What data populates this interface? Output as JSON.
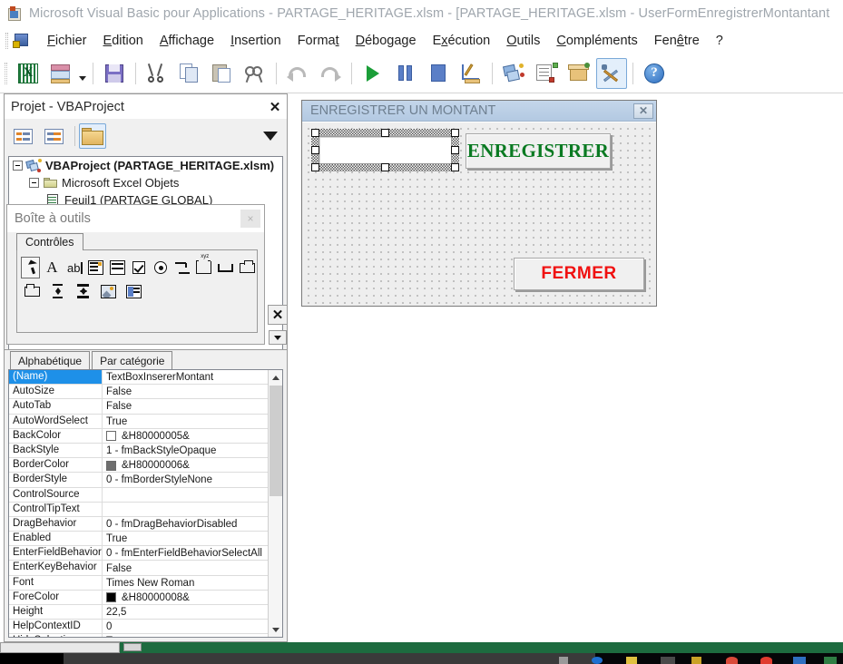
{
  "window": {
    "title": "Microsoft Visual Basic pour Applications - PARTAGE_HERITAGE.xlsm - [PARTAGE_HERITAGE.xlsm - UserFormEnregistrerMontantant",
    "app_icon": "vba-excel-icon"
  },
  "menubar": {
    "items": [
      {
        "label": "Fichier"
      },
      {
        "label": "Edition"
      },
      {
        "label": "Affichage"
      },
      {
        "label": "Insertion"
      },
      {
        "label": "Format"
      },
      {
        "label": "Débogage"
      },
      {
        "label": "Exécution"
      },
      {
        "label": "Outils"
      },
      {
        "label": "Compléments"
      },
      {
        "label": "Fenêtre"
      },
      {
        "label": "?"
      }
    ]
  },
  "toolbar": {
    "buttons": [
      {
        "name": "view-excel-icon"
      },
      {
        "name": "insert-userform-icon"
      },
      {
        "name": "save-icon"
      },
      {
        "name": "cut-icon"
      },
      {
        "name": "copy-icon"
      },
      {
        "name": "paste-icon"
      },
      {
        "name": "find-icon"
      },
      {
        "name": "undo-icon"
      },
      {
        "name": "redo-icon"
      },
      {
        "name": "run-icon"
      },
      {
        "name": "break-icon"
      },
      {
        "name": "reset-icon"
      },
      {
        "name": "design-mode-icon"
      },
      {
        "name": "project-explorer-icon"
      },
      {
        "name": "properties-window-icon"
      },
      {
        "name": "object-browser-icon"
      },
      {
        "name": "toolbox-icon"
      },
      {
        "name": "help-icon"
      }
    ]
  },
  "project_panel": {
    "title": "Projet - VBAProject",
    "close_label": "✕",
    "toolbar": {
      "view_code_label": "view-code-icon",
      "view_object_label": "view-object-icon",
      "toggle_folders_label": "toggle-folders-icon"
    },
    "tree": [
      {
        "label": "VBAProject (PARTAGE_HERITAGE.xlsm)",
        "level": 0,
        "icon": "vbaproject-icon",
        "bold": true
      },
      {
        "label": "Microsoft Excel Objets",
        "level": 1,
        "icon": "folder-icon",
        "bold": false
      },
      {
        "label": "Feuil1 (PARTAGE GLOBAL)",
        "level": 2,
        "icon": "worksheet-icon",
        "bold": false
      }
    ]
  },
  "toolbox": {
    "title": "Boîte à outils",
    "close_label": "×",
    "tabs": [
      {
        "label": "Contrôles",
        "active": true
      }
    ],
    "controls_row1": [
      {
        "name": "select-objects-icon",
        "selected": true
      },
      {
        "name": "label-icon",
        "selected": false
      },
      {
        "name": "textbox-icon",
        "selected": false
      },
      {
        "name": "combobox-icon",
        "selected": false
      },
      {
        "name": "listbox-icon",
        "selected": false
      },
      {
        "name": "checkbox-icon",
        "selected": false
      },
      {
        "name": "optionbutton-icon",
        "selected": false
      },
      {
        "name": "togglebutton-icon",
        "selected": false
      },
      {
        "name": "frame-icon",
        "selected": false
      },
      {
        "name": "commandbutton-icon",
        "selected": false
      },
      {
        "name": "tabstrip-icon",
        "selected": false
      }
    ],
    "controls_row2": [
      {
        "name": "multipage-icon",
        "selected": false
      },
      {
        "name": "scrollbar-icon",
        "selected": false
      },
      {
        "name": "spinbutton-icon",
        "selected": false
      },
      {
        "name": "image-icon",
        "selected": false
      },
      {
        "name": "refedit-icon",
        "selected": false
      }
    ]
  },
  "properties": {
    "tabs": [
      {
        "label": "Alphabétique",
        "active": true
      },
      {
        "label": "Par catégorie",
        "active": false
      }
    ],
    "rows": [
      {
        "key": "(Name)",
        "value": "TextBoxInsererMontant",
        "selected": true
      },
      {
        "key": "AutoSize",
        "value": "False"
      },
      {
        "key": "AutoTab",
        "value": "False"
      },
      {
        "key": "AutoWordSelect",
        "value": "True"
      },
      {
        "key": "BackColor",
        "value": "&H80000005&",
        "swatch": "#ffffff"
      },
      {
        "key": "BackStyle",
        "value": "1 - fmBackStyleOpaque"
      },
      {
        "key": "BorderColor",
        "value": "&H80000006&",
        "swatch": "#6e6e6e"
      },
      {
        "key": "BorderStyle",
        "value": "0 - fmBorderStyleNone"
      },
      {
        "key": "ControlSource",
        "value": ""
      },
      {
        "key": "ControlTipText",
        "value": ""
      },
      {
        "key": "DragBehavior",
        "value": "0 - fmDragBehaviorDisabled"
      },
      {
        "key": "Enabled",
        "value": "True"
      },
      {
        "key": "EnterFieldBehavior",
        "value": "0 - fmEnterFieldBehaviorSelectAll"
      },
      {
        "key": "EnterKeyBehavior",
        "value": "False"
      },
      {
        "key": "Font",
        "value": "Times New Roman"
      },
      {
        "key": "ForeColor",
        "value": "&H80000008&",
        "swatch": "#000000"
      },
      {
        "key": "Height",
        "value": "22,5"
      },
      {
        "key": "HelpContextID",
        "value": "0"
      },
      {
        "key": "HideSelection",
        "value": "True"
      }
    ]
  },
  "designer": {
    "form_caption": "ENREGISTRER UN MONTANT",
    "form_close_label": "✕",
    "textbox": {
      "name": "TextBoxInsererMontant",
      "value": "",
      "selected": true
    },
    "save_button_label": "ENREGISTRER",
    "save_button_color": "#0a7a22",
    "close_button_label": "FERMER",
    "close_button_color": "#f01010"
  },
  "colors": {
    "form_caption_bg": "#b8cce4",
    "selection_blue": "#1e90e8",
    "taskbar_strip": "#1d6b3f"
  }
}
